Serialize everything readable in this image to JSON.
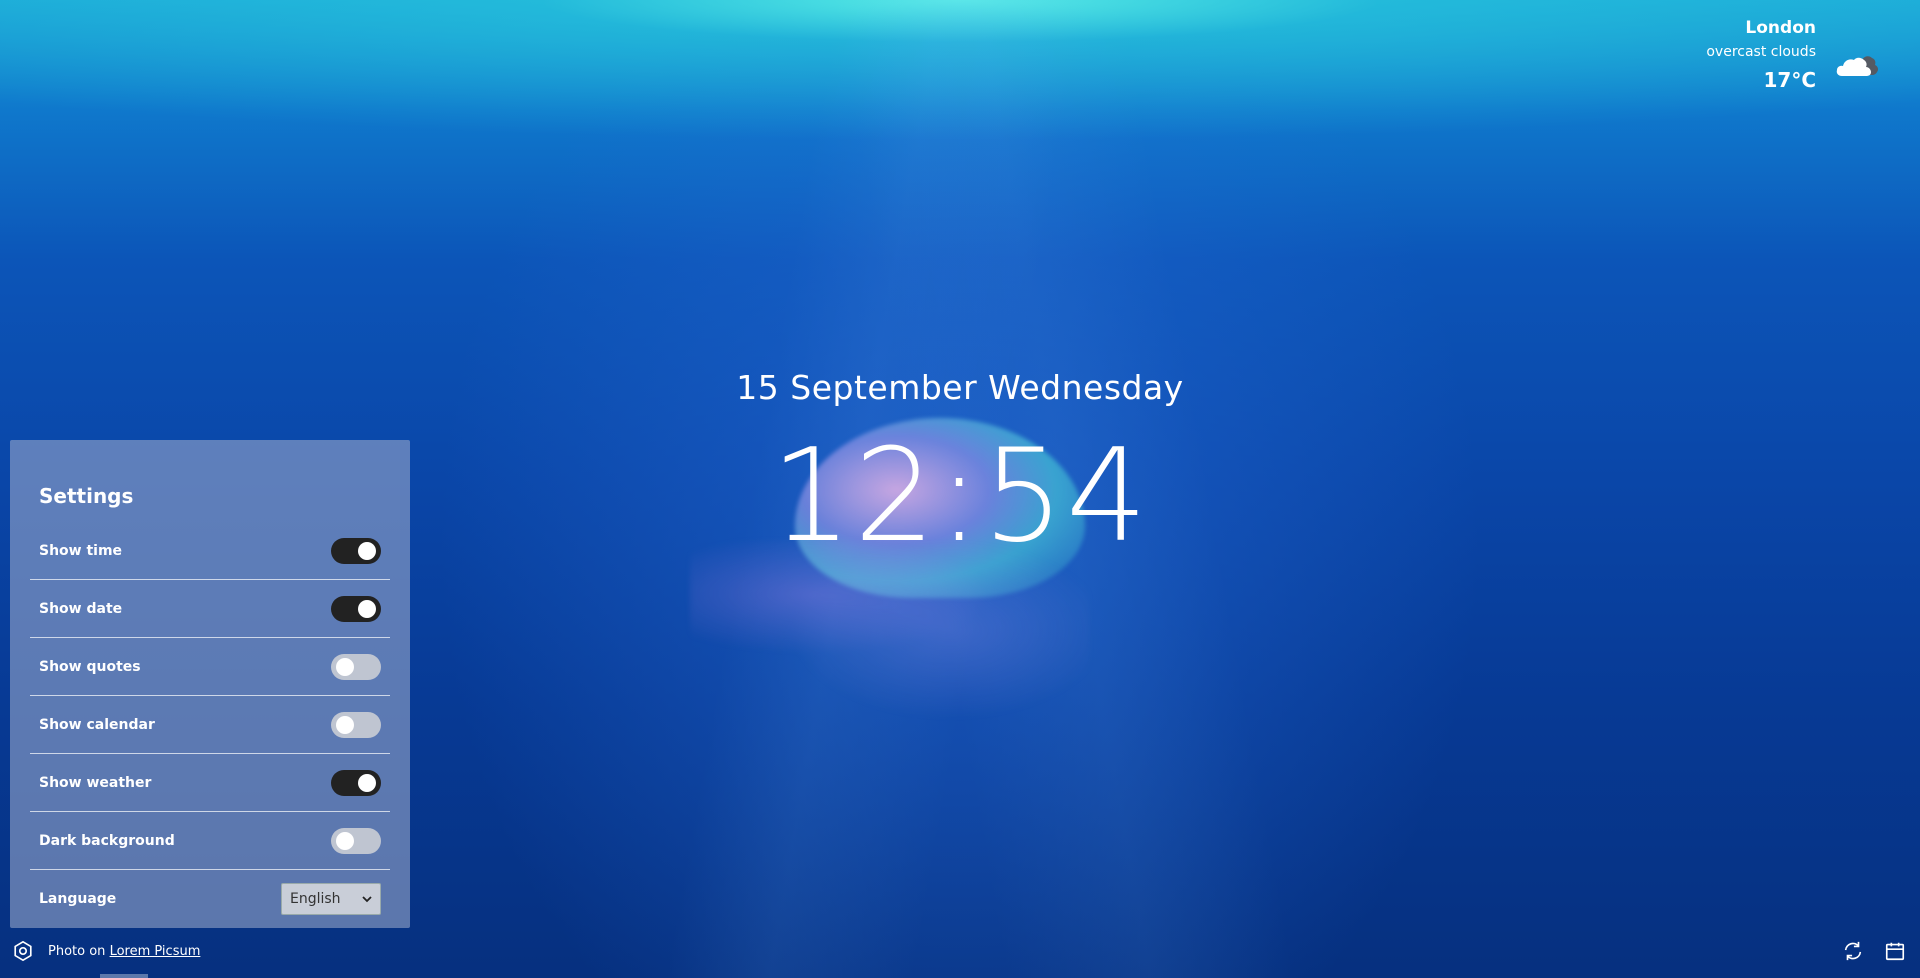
{
  "weather": {
    "city": "London",
    "description": "overcast clouds",
    "temperature": "17°C",
    "icon": "cloud-icon"
  },
  "clock": {
    "date": "15 September Wednesday",
    "time": "12:54"
  },
  "settings": {
    "title": "Settings",
    "items": [
      {
        "label": "Show time",
        "state": "on"
      },
      {
        "label": "Show date",
        "state": "on"
      },
      {
        "label": "Show quotes",
        "state": "off"
      },
      {
        "label": "Show calendar",
        "state": "off"
      },
      {
        "label": "Show weather",
        "state": "on"
      },
      {
        "label": "Dark background",
        "state": "off"
      }
    ],
    "language": {
      "label": "Language",
      "selected": "English"
    }
  },
  "footer": {
    "photo_prefix": "Photo on",
    "photo_link": "Lorem Picsum",
    "settings_icon": "gear-icon",
    "refresh_icon": "refresh-icon",
    "calendar_icon": "calendar-icon"
  },
  "colors": {
    "panel": "#96a5c8",
    "toggle_on": "#222222",
    "toggle_off": "#bfc5d1"
  }
}
